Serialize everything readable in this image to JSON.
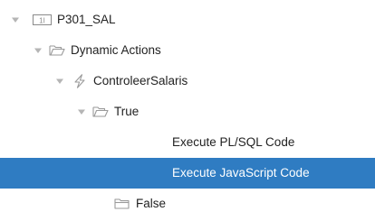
{
  "tree": {
    "root": {
      "badge": "1I",
      "label": "P301_SAL",
      "expanded": true,
      "icon": "page-item-icon"
    },
    "dynamic_actions": {
      "label": "Dynamic Actions",
      "expanded": true,
      "icon": "folder-open-icon"
    },
    "action": {
      "label": "ControleerSalaris",
      "expanded": true,
      "icon": "lightning-icon"
    },
    "true_branch": {
      "label": "True",
      "expanded": true,
      "icon": "folder-open-icon"
    },
    "true_items": [
      {
        "label": "Execute PL/SQL Code",
        "selected": false
      },
      {
        "label": "Execute JavaScript Code",
        "selected": true
      }
    ],
    "false_branch": {
      "label": "False",
      "icon": "folder-icon"
    }
  },
  "colors": {
    "selection": "#2f7cc2",
    "selection_text": "#ffffff",
    "text": "#222222",
    "icon": "#9a9a9a",
    "toggle": "#b5b5b5"
  }
}
